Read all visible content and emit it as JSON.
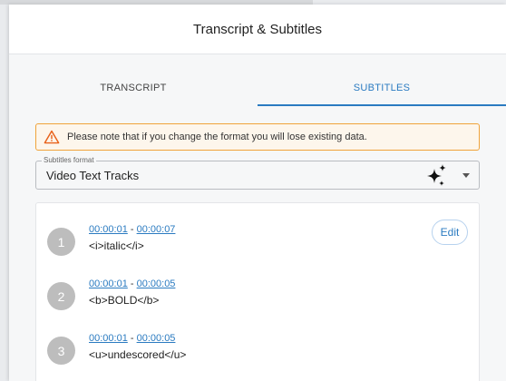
{
  "header": {
    "title": "Transcript & Subtitles"
  },
  "tabs": [
    {
      "label": "TRANSCRIPT",
      "active": false
    },
    {
      "label": "SUBTITLES",
      "active": true
    }
  ],
  "warning": {
    "icon": "warning-triangle-icon",
    "text": "Please note that if you change the format you will lose existing data."
  },
  "format": {
    "legend": "Subtitles format",
    "value": "Video Text Tracks",
    "icon": "sparkle-icon"
  },
  "subtitles": [
    {
      "index": "1",
      "start": "00:00:01",
      "sep": " - ",
      "end": "00:00:07",
      "text": "<i>italic</i>"
    },
    {
      "index": "2",
      "start": "00:00:01",
      "sep": " - ",
      "end": "00:00:05",
      "text": "<b>BOLD</b>"
    },
    {
      "index": "3",
      "start": "00:00:01",
      "sep": " - ",
      "end": "00:00:05",
      "text": "<u>undescored</u>"
    }
  ],
  "edit_label": "Edit",
  "colors": {
    "accent": "#2b7bc1",
    "warning_border": "#f0a33a",
    "warning_icon": "#e8611a"
  }
}
